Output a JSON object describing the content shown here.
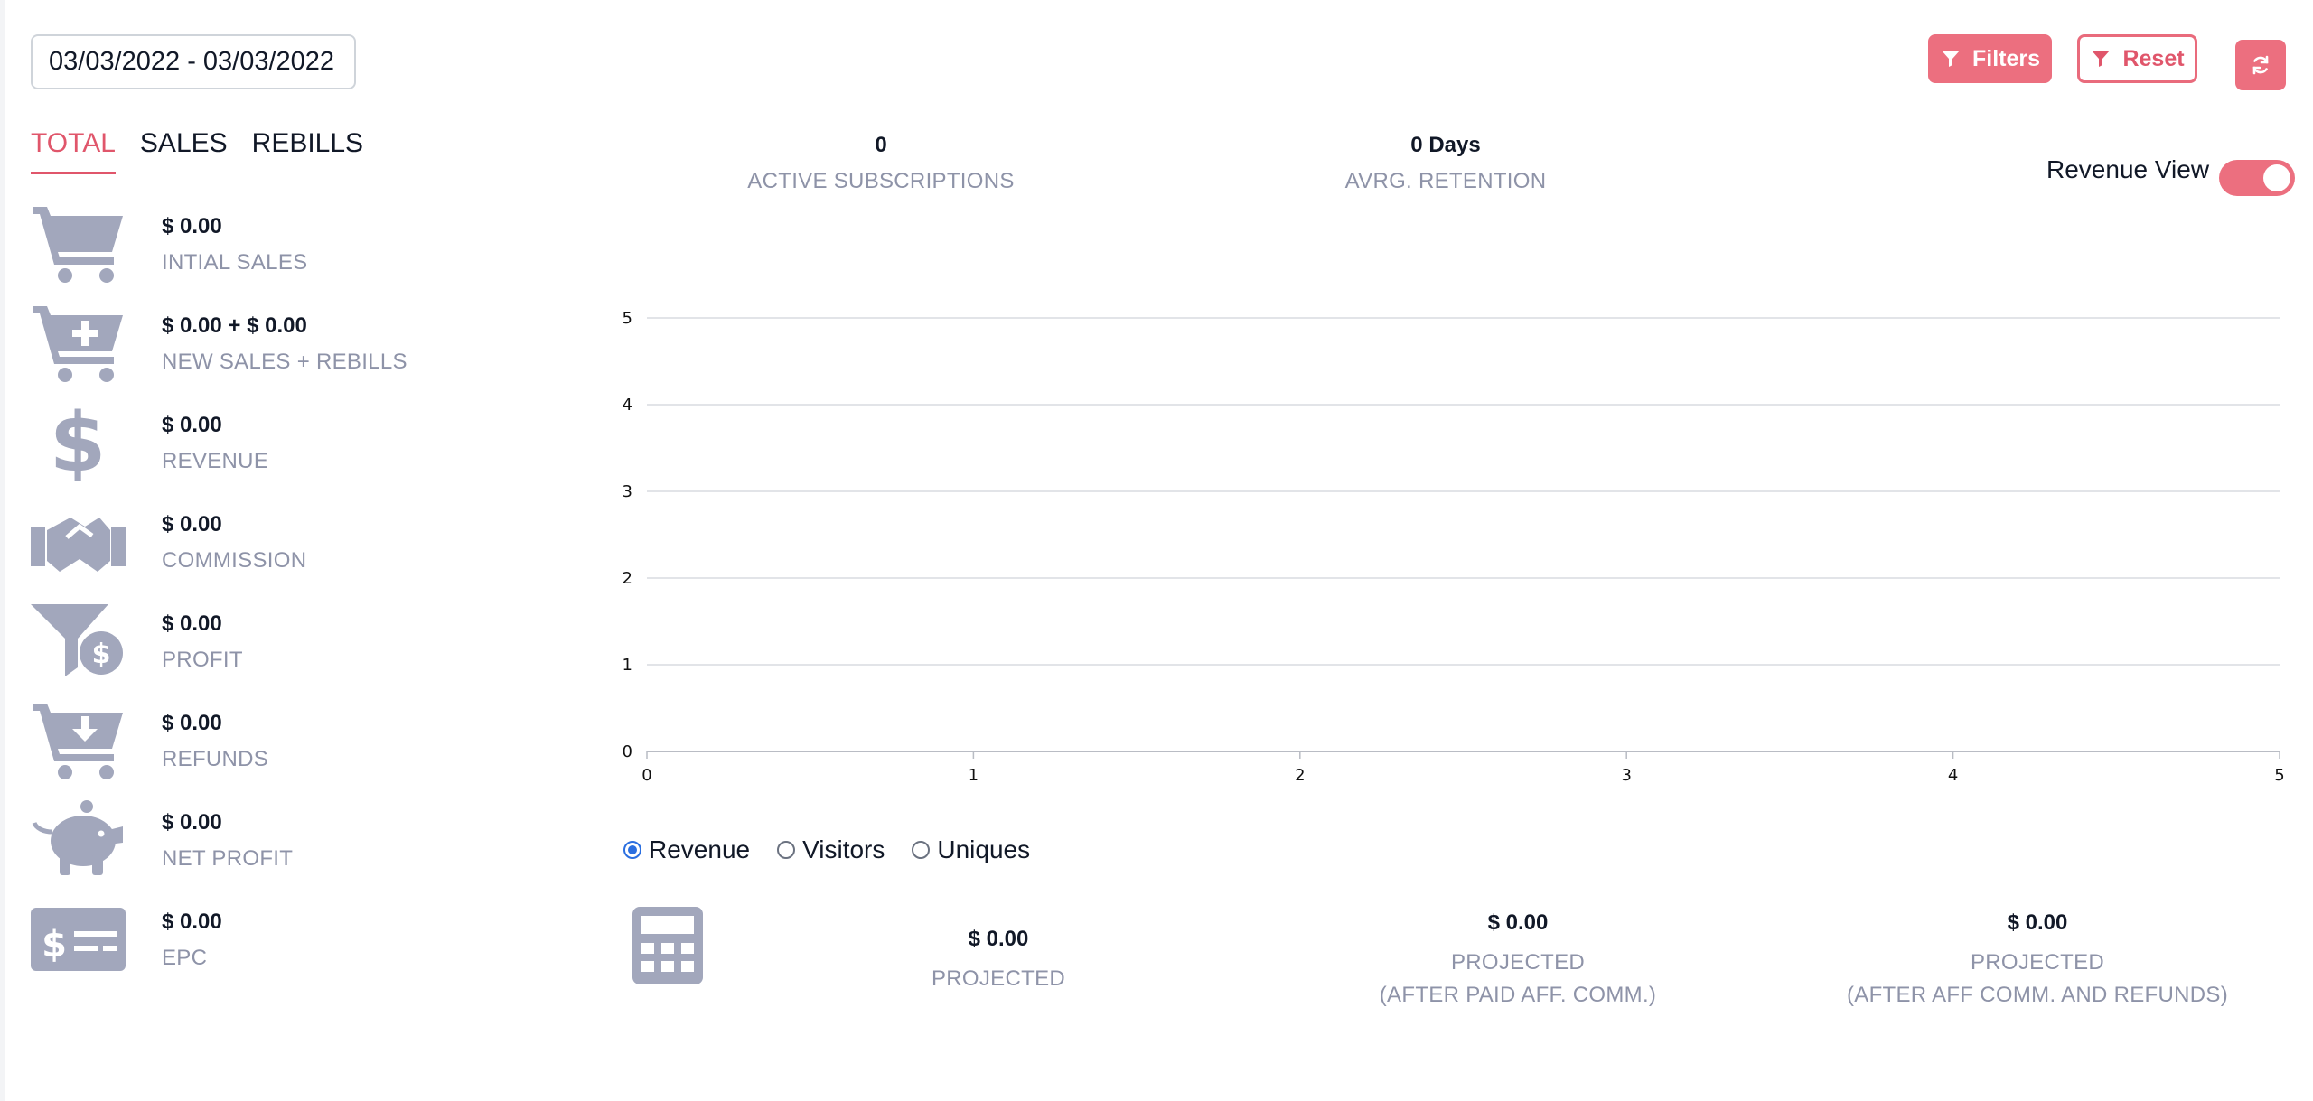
{
  "date_range": "03/03/2022 - 03/03/2022",
  "toolbar": {
    "filters_label": "Filters",
    "reset_label": "Reset"
  },
  "tabs": [
    {
      "label": "TOTAL",
      "active": true
    },
    {
      "label": "SALES",
      "active": false
    },
    {
      "label": "REBILLS",
      "active": false
    }
  ],
  "metrics": [
    {
      "icon": "cart-icon",
      "value": "$ 0.00",
      "label": "INTIAL SALES"
    },
    {
      "icon": "cart-plus-icon",
      "value": "$ 0.00 + $ 0.00",
      "label": "NEW SALES + REBILLS"
    },
    {
      "icon": "dollar-icon",
      "value": "$ 0.00",
      "label": "REVENUE"
    },
    {
      "icon": "handshake-icon",
      "value": "$ 0.00",
      "label": "COMMISSION"
    },
    {
      "icon": "funnel-dollar-icon",
      "value": "$ 0.00",
      "label": "PROFIT"
    },
    {
      "icon": "cart-arrow-down-icon",
      "value": "$ 0.00",
      "label": "REFUNDS"
    },
    {
      "icon": "piggy-bank-icon",
      "value": "$ 0.00",
      "label": "NET PROFIT"
    },
    {
      "icon": "money-check-icon",
      "value": "$ 0.00",
      "label": "EPC"
    }
  ],
  "stats": {
    "active_subscriptions": {
      "value": "0",
      "label": "ACTIVE SUBSCRIPTIONS"
    },
    "avg_retention": {
      "value": "0 Days",
      "label": "AVRG. RETENTION"
    }
  },
  "revenue_view": {
    "label": "Revenue View",
    "on": true
  },
  "chart_data": {
    "type": "line",
    "x": [],
    "series": [],
    "xlim": [
      0,
      5
    ],
    "ylim": [
      0,
      5
    ],
    "x_ticks": [
      "0",
      "1",
      "2",
      "3",
      "4",
      "5"
    ],
    "y_ticks": [
      "0",
      "1",
      "2",
      "3",
      "4",
      "5"
    ],
    "grid": true
  },
  "chart_modes": [
    {
      "label": "Revenue",
      "selected": true
    },
    {
      "label": "Visitors",
      "selected": false
    },
    {
      "label": "Uniques",
      "selected": false
    }
  ],
  "projected": [
    {
      "value": "$ 0.00",
      "label": "PROJECTED",
      "sub": ""
    },
    {
      "value": "$ 0.00",
      "label": "PROJECTED",
      "sub": "(AFTER PAID AFF. COMM.)"
    },
    {
      "value": "$ 0.00",
      "label": "PROJECTED",
      "sub": "(AFTER AFF COMM. AND REFUNDS)"
    }
  ],
  "colors": {
    "accent": "#ec6f7f",
    "icon": "#a2a7bc",
    "muted_text": "#8e93a8",
    "radio": "#2b6fe0"
  }
}
